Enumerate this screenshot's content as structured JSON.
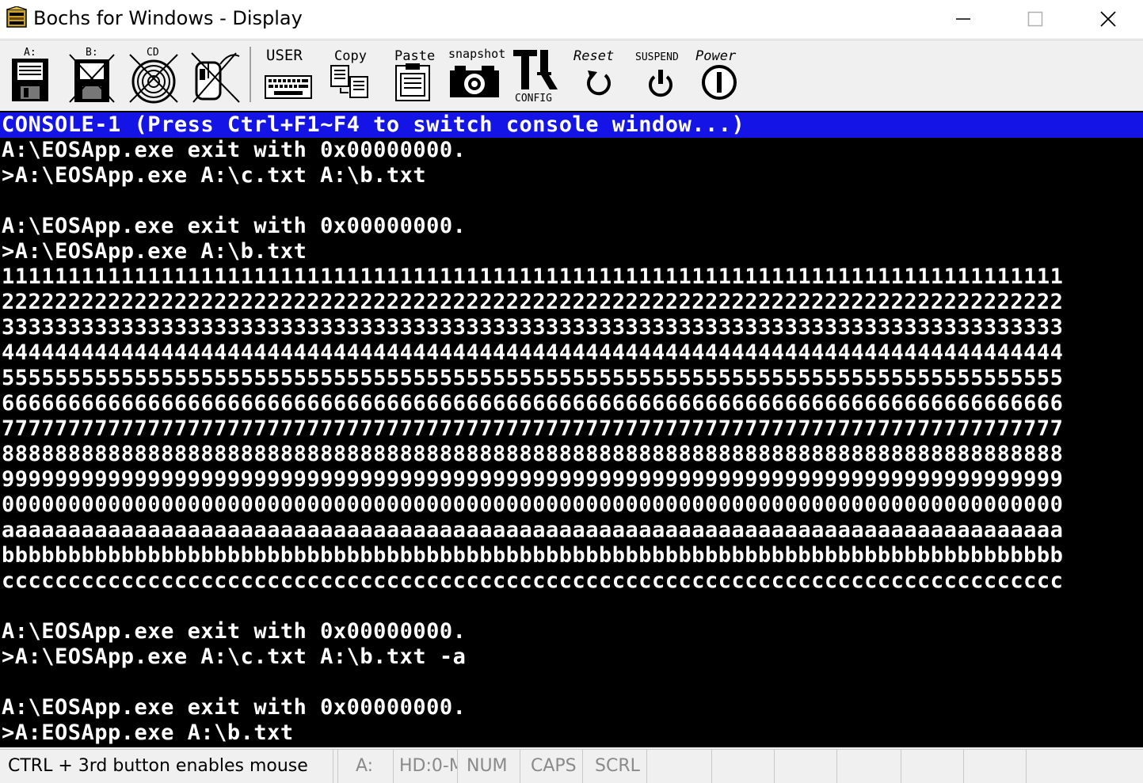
{
  "window": {
    "title": "Bochs for Windows - Display",
    "icon": "bochs-app-icon",
    "controls": [
      "minimize-icon",
      "maximize-icon",
      "close-icon"
    ]
  },
  "toolbar": {
    "floppy_a": "A:",
    "floppy_b": "B:",
    "cdrom": "CD",
    "user": "USER",
    "copy": "Copy",
    "paste": "Paste",
    "snapshot": "snapshot",
    "config": "CONFIG",
    "reset": "Reset",
    "suspend": "SUSPEND",
    "power": "Power"
  },
  "console": {
    "header": "CONSOLE-1 (Press Ctrl+F1~F4 to switch console window...)",
    "lines": [
      "A:\\EOSApp.exe exit with 0x00000000.",
      ">A:\\EOSApp.exe A:\\c.txt A:\\b.txt",
      "",
      "A:\\EOSApp.exe exit with 0x00000000.",
      ">A:\\EOSApp.exe A:\\b.txt",
      "11111111111111111111111111111111111111111111111111111111111111111111111111111111",
      "22222222222222222222222222222222222222222222222222222222222222222222222222222222",
      "33333333333333333333333333333333333333333333333333333333333333333333333333333333",
      "44444444444444444444444444444444444444444444444444444444444444444444444444444444",
      "55555555555555555555555555555555555555555555555555555555555555555555555555555555",
      "66666666666666666666666666666666666666666666666666666666666666666666666666666666",
      "77777777777777777777777777777777777777777777777777777777777777777777777777777777",
      "88888888888888888888888888888888888888888888888888888888888888888888888888888888",
      "99999999999999999999999999999999999999999999999999999999999999999999999999999999",
      "00000000000000000000000000000000000000000000000000000000000000000000000000000000",
      "aaaaaaaaaaaaaaaaaaaaaaaaaaaaaaaaaaaaaaaaaaaaaaaaaaaaaaaaaaaaaaaaaaaaaaaaaaaaaaaa",
      "bbbbbbbbbbbbbbbbbbbbbbbbbbbbbbbbbbbbbbbbbbbbbbbbbbbbbbbbbbbbbbbbbbbbbbbbbbbbbbbb",
      "cccccccccccccccccccccccccccccccccccccccccccccccccccccccccccccccccccccccccccccccc",
      "",
      "A:\\EOSApp.exe exit with 0x00000000.",
      ">A:\\EOSApp.exe A:\\c.txt A:\\b.txt -a",
      "",
      "A:\\EOSApp.exe exit with 0x00000000.",
      ">A:EOSApp.exe A:\\b.txt"
    ]
  },
  "statusbar": {
    "mouse_hint": "CTRL + 3rd button enables mouse",
    "drive": "A:",
    "hd": "HD:0-M",
    "num": "NUM",
    "caps": "CAPS",
    "scrl": "SCRL"
  },
  "colors": {
    "console_bg": "#000000",
    "console_fg": "#ffffff",
    "header_bg": "#1414e6",
    "toolbar_bg": "#f0f0f0"
  }
}
